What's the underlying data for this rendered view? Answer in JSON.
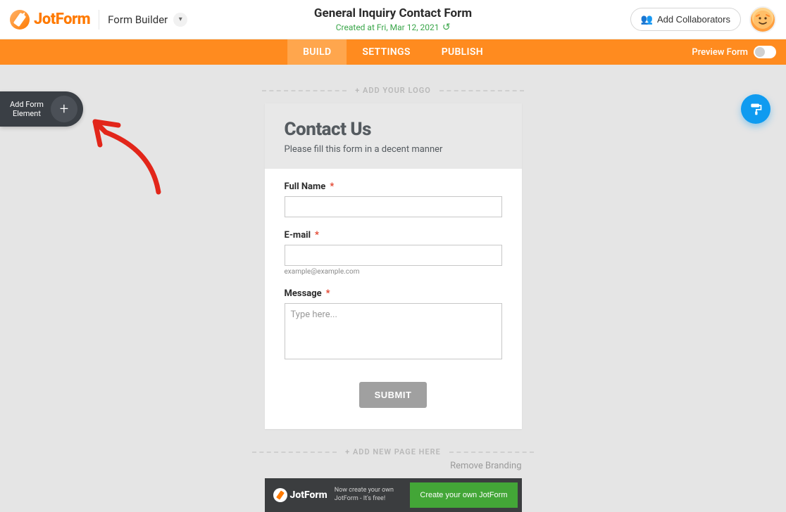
{
  "header": {
    "logo_text": "JotForm",
    "form_builder_label": "Form Builder",
    "title": "General Inquiry Contact Form",
    "created": "Created at Fri, Mar 12, 2021",
    "collab_label": "Add Collaborators"
  },
  "nav": {
    "tabs": [
      "BUILD",
      "SETTINGS",
      "PUBLISH"
    ],
    "active": 0,
    "preview_label": "Preview Form"
  },
  "sidebar": {
    "add_element_line1": "Add Form",
    "add_element_line2": "Element"
  },
  "logo_row": {
    "label": "+ ADD YOUR LOGO"
  },
  "form": {
    "title": "Contact Us",
    "subtitle": "Please fill this form in a decent manner",
    "fields": {
      "full_name": {
        "label": "Full Name"
      },
      "email": {
        "label": "E-mail",
        "hint": "example@example.com"
      },
      "message": {
        "label": "Message",
        "placeholder": "Type here..."
      }
    },
    "submit_label": "SUBMIT"
  },
  "add_page": {
    "label": "+ ADD NEW PAGE HERE"
  },
  "remove_branding": "Remove Branding",
  "promo": {
    "logo_text": "JotForm",
    "tagline": "Now create your own JotForm - It's free!",
    "cta_label": "Create your own JotForm"
  }
}
